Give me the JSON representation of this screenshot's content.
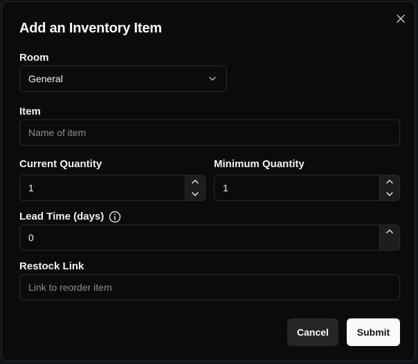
{
  "dialog": {
    "title": "Add an Inventory Item",
    "close_icon": "close-icon"
  },
  "room": {
    "label": "Room",
    "selected": "General",
    "icon": "chevron-down-icon"
  },
  "item": {
    "label": "Item",
    "placeholder": "Name of item",
    "value": ""
  },
  "current_quantity": {
    "label": "Current Quantity",
    "value": "1"
  },
  "minimum_quantity": {
    "label": "Minimum Quantity",
    "value": "1"
  },
  "lead_time": {
    "label": "Lead Time (days)",
    "value": "0",
    "info_icon": "info-icon"
  },
  "restock_link": {
    "label": "Restock Link",
    "placeholder": "Link to reorder item",
    "value": ""
  },
  "actions": {
    "cancel_label": "Cancel",
    "submit_label": "Submit"
  },
  "colors": {
    "dialog_bg": "#0b0b0b",
    "border": "#2b2b2b",
    "primary_button": "#fafafa",
    "secondary_button": "#262626"
  }
}
